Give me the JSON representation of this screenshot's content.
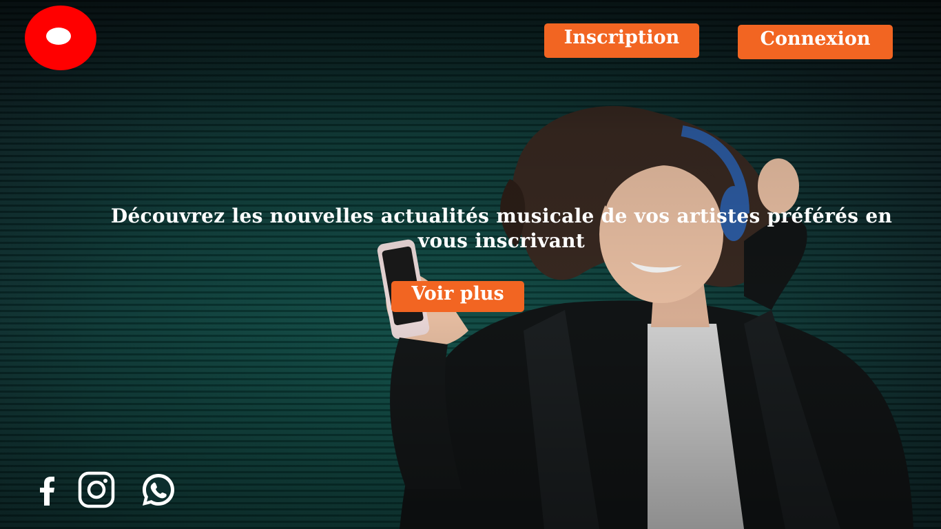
{
  "header": {
    "logo": "red-circle-logo",
    "signup_label": "Inscription",
    "login_label": "Connexion"
  },
  "hero": {
    "headline": "Découvrez les nouvelles actualités musicale de vos artistes préférés en vous inscrivant",
    "cta_label": "Voir plus"
  },
  "social": [
    {
      "name": "facebook",
      "icon": "facebook-icon"
    },
    {
      "name": "instagram",
      "icon": "instagram-icon"
    },
    {
      "name": "whatsapp",
      "icon": "whatsapp-icon"
    }
  ],
  "colors": {
    "accent": "#f26522",
    "logo": "#ff0000",
    "text": "#ffffff",
    "background": "#0b3a37"
  }
}
